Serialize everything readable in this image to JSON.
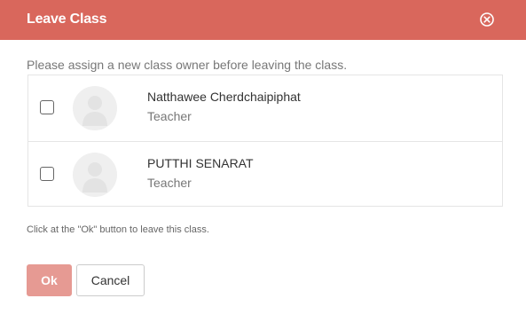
{
  "dialog": {
    "title": "Leave Class",
    "close_icon": "close-circle-icon",
    "instruction": "Please assign a new class owner before leaving the class.",
    "footnote": "Click at the \"Ok\" button to leave this class."
  },
  "members": [
    {
      "name": "Natthawee Cherdchaipiphat",
      "role": "Teacher",
      "checked": false
    },
    {
      "name": "PUTTHI SENARAT",
      "role": "Teacher",
      "checked": false
    }
  ],
  "buttons": {
    "ok_label": "Ok",
    "cancel_label": "Cancel"
  },
  "colors": {
    "header": "#d9675c",
    "ok_button": "#e69a93"
  }
}
